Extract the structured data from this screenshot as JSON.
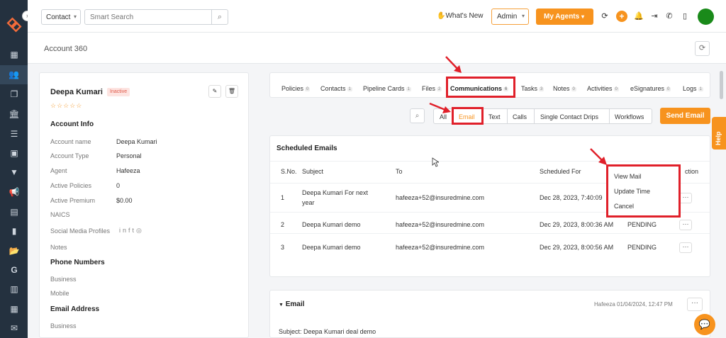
{
  "topbar": {
    "contact_select": "Contact",
    "search_placeholder": "Smart Search",
    "whats_new": "What's New",
    "admin_select": "Admin",
    "my_agents": "My Agents"
  },
  "page": {
    "title": "Account 360"
  },
  "account": {
    "name": "Deepa Kumari",
    "status": "Inactive",
    "info_title": "Account Info",
    "fields": [
      {
        "label": "Account name",
        "value": "Deepa Kumari"
      },
      {
        "label": "Account Type",
        "value": "Personal"
      },
      {
        "label": "Agent",
        "value": "Hafeeza"
      },
      {
        "label": "Active Policies",
        "value": "0"
      },
      {
        "label": "Active Premium",
        "value": "$0.00"
      },
      {
        "label": "NAICS",
        "value": ""
      }
    ],
    "social_label": "Social Media Profiles",
    "notes_label": "Notes",
    "phone_title": "Phone Numbers",
    "business_label": "Business",
    "mobile_label": "Mobile",
    "email_title": "Email Address",
    "email_business_label": "Business"
  },
  "tabs": [
    {
      "label": "Policies",
      "count": "0"
    },
    {
      "label": "Contacts",
      "count": "1"
    },
    {
      "label": "Pipeline Cards",
      "count": "1"
    },
    {
      "label": "Files",
      "count": "2"
    },
    {
      "label": "Communications",
      "count": "6"
    },
    {
      "label": "Tasks",
      "count": "3"
    },
    {
      "label": "Notes",
      "count": "0"
    },
    {
      "label": "Activities",
      "count": "0"
    },
    {
      "label": "eSignatures",
      "count": "0"
    },
    {
      "label": "Logs",
      "count": "1"
    }
  ],
  "subtabs": [
    "All",
    "Email",
    "Text",
    "Calls",
    "Single Contact Drips",
    "Workflows"
  ],
  "send_email": "Send Email",
  "scheduled": {
    "title": "Scheduled Emails",
    "headers": [
      "S.No.",
      "Subject",
      "To",
      "Scheduled For",
      "Action"
    ],
    "rows": [
      {
        "sno": "1",
        "subject_line1": "Deepa Kumari For next",
        "subject_line2": "year",
        "to": "hafeeza+52@insuredmine.com",
        "scheduled": "Dec 28, 2023, 7:40:09",
        "status": ""
      },
      {
        "sno": "2",
        "subject_line1": "Deepa Kumari demo",
        "subject_line2": "",
        "to": "hafeeza+52@insuredmine.com",
        "scheduled": "Dec 29, 2023, 8:00:36 AM",
        "status": "PENDING"
      },
      {
        "sno": "3",
        "subject_line1": "Deepa Kumari demo",
        "subject_line2": "",
        "to": "hafeeza+52@insuredmine.com",
        "scheduled": "Dec 29, 2023, 8:00:56 AM",
        "status": "PENDING"
      }
    ],
    "menu": [
      "View Mail",
      "Update Time",
      "Cancel"
    ],
    "action_header_visible": "ction"
  },
  "email_card": {
    "title": "Email",
    "meta": "Hafeeza 01/04/2024, 12:47 PM",
    "subject": "Subject: Deepa Kumari deal demo"
  },
  "help": "Help",
  "colors": {
    "accent": "#f7931e",
    "sidebar": "#24313f",
    "highlight": "#e0202a"
  }
}
